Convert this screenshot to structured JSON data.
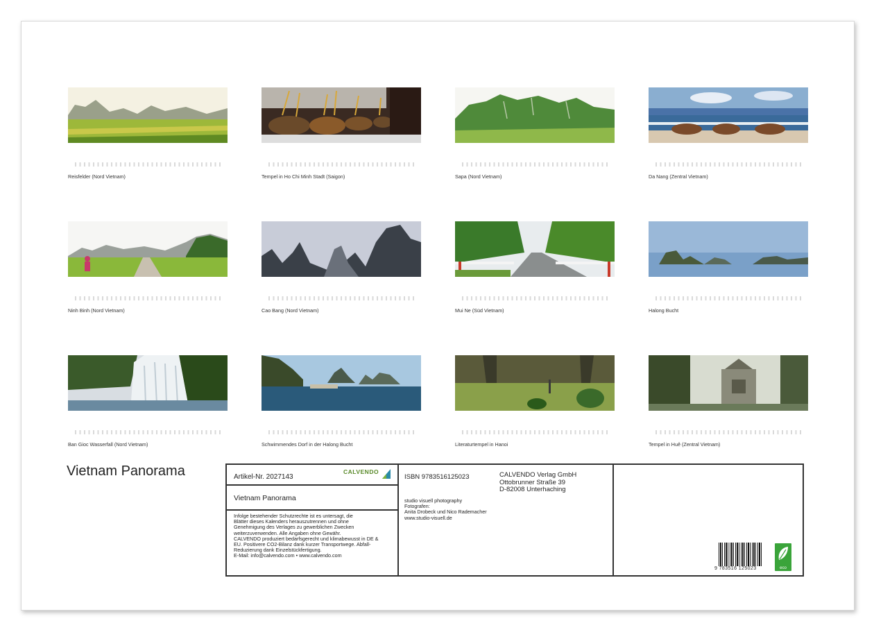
{
  "calendar": {
    "title": "Vietnam Panorama",
    "months": [
      {
        "caption": "Reisfelder (Nord Vietnam)",
        "scene": "rice-fields"
      },
      {
        "caption": "Tempel in Ho Chi Minh Stadt (Saigon)",
        "scene": "incense-temple"
      },
      {
        "caption": "Sapa (Nord Vietnam)",
        "scene": "green-hills"
      },
      {
        "caption": "Da Nang (Zentral Vietnam)",
        "scene": "basket-boats-beach"
      },
      {
        "caption": "Ninh Binh (Nord Vietnam)",
        "scene": "road-through-fields"
      },
      {
        "caption": "Cao Bang (Nord Vietnam)",
        "scene": "misty-karst"
      },
      {
        "caption": "Mui Ne (Süd Vietnam)",
        "scene": "bridge-road"
      },
      {
        "caption": "Halong Bucht",
        "scene": "bay-islands"
      },
      {
        "caption": "Ban Gioc Wasserfall (Nord Vietnam)",
        "scene": "waterfall"
      },
      {
        "caption": "Schwimmendes Dorf in der Halong Bucht",
        "scene": "floating-village"
      },
      {
        "caption": "Literaturtempel in Hanoi",
        "scene": "temple-garden"
      },
      {
        "caption": "Tempel in Huê (Zentral Vietnam)",
        "scene": "stone-shrine"
      }
    ]
  },
  "info_box": {
    "article": "Artikel-Nr. 2027143",
    "logo_text": "CALVENDO",
    "title": "Vietnam Panorama",
    "legal_lines": [
      "Infolge bestehender Schutzrechte ist es untersagt, die",
      "Blätter dieses Kalenders herauszutrennen und ohne",
      "Genehmigung des Verlages zu gewerblichen Zwecken",
      "weiterzuverwenden. Alle Angaben ohne Gewähr.",
      "CALVENDO produziert bedarfsgerecht und klimabewusst in DE &",
      "EU. Positivere CO2-Bilanz dank kurzer Transportwege. Abfall-",
      "Reduzierung dank Einzelstückfertigung.",
      "E-Mail: info@calvendo.com • www.calvendo.com"
    ],
    "isbn": "ISBN 9783516125023",
    "publisher": {
      "name": "CALVENDO Verlag GmbH",
      "street": "Ottobrunner Straße 39",
      "city": "D-82008 Unterhaching"
    },
    "photographer_lines": [
      "studio visuell photography",
      "Fotografen:",
      "Anita Drobeck und Nico Rademacher",
      "www.studio-visuell.de"
    ],
    "barcode_number": "9 783516 125023",
    "eco_label": "eco"
  }
}
